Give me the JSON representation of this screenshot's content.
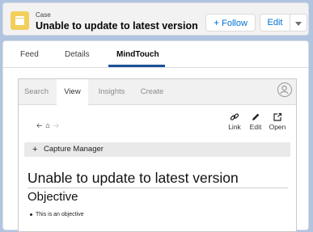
{
  "record": {
    "object_label": "Case",
    "title": "Unable to update to latest version",
    "follow_label": "Follow",
    "edit_label": "Edit"
  },
  "tabs": [
    {
      "label": "Feed"
    },
    {
      "label": "Details"
    },
    {
      "label": "MindTouch",
      "active": true
    }
  ],
  "mindtouch": {
    "tabs": [
      {
        "label": "Search"
      },
      {
        "label": "View",
        "active": true
      },
      {
        "label": "Insights"
      },
      {
        "label": "Create"
      }
    ],
    "tools": [
      {
        "label": "Link",
        "icon": "link-icon"
      },
      {
        "label": "Edit",
        "icon": "pencil-icon"
      },
      {
        "label": "Open",
        "icon": "open-external-icon"
      }
    ],
    "capture_label": "Capture Manager",
    "article": {
      "title": "Unable to update to latest version",
      "heading": "Objective",
      "bullets": [
        "This is an objective"
      ]
    }
  },
  "colors": {
    "background": "#b0c4df",
    "accent": "#0070d2",
    "record_icon": "#f2cf5b",
    "active_tab_underline": "#1b5297"
  }
}
